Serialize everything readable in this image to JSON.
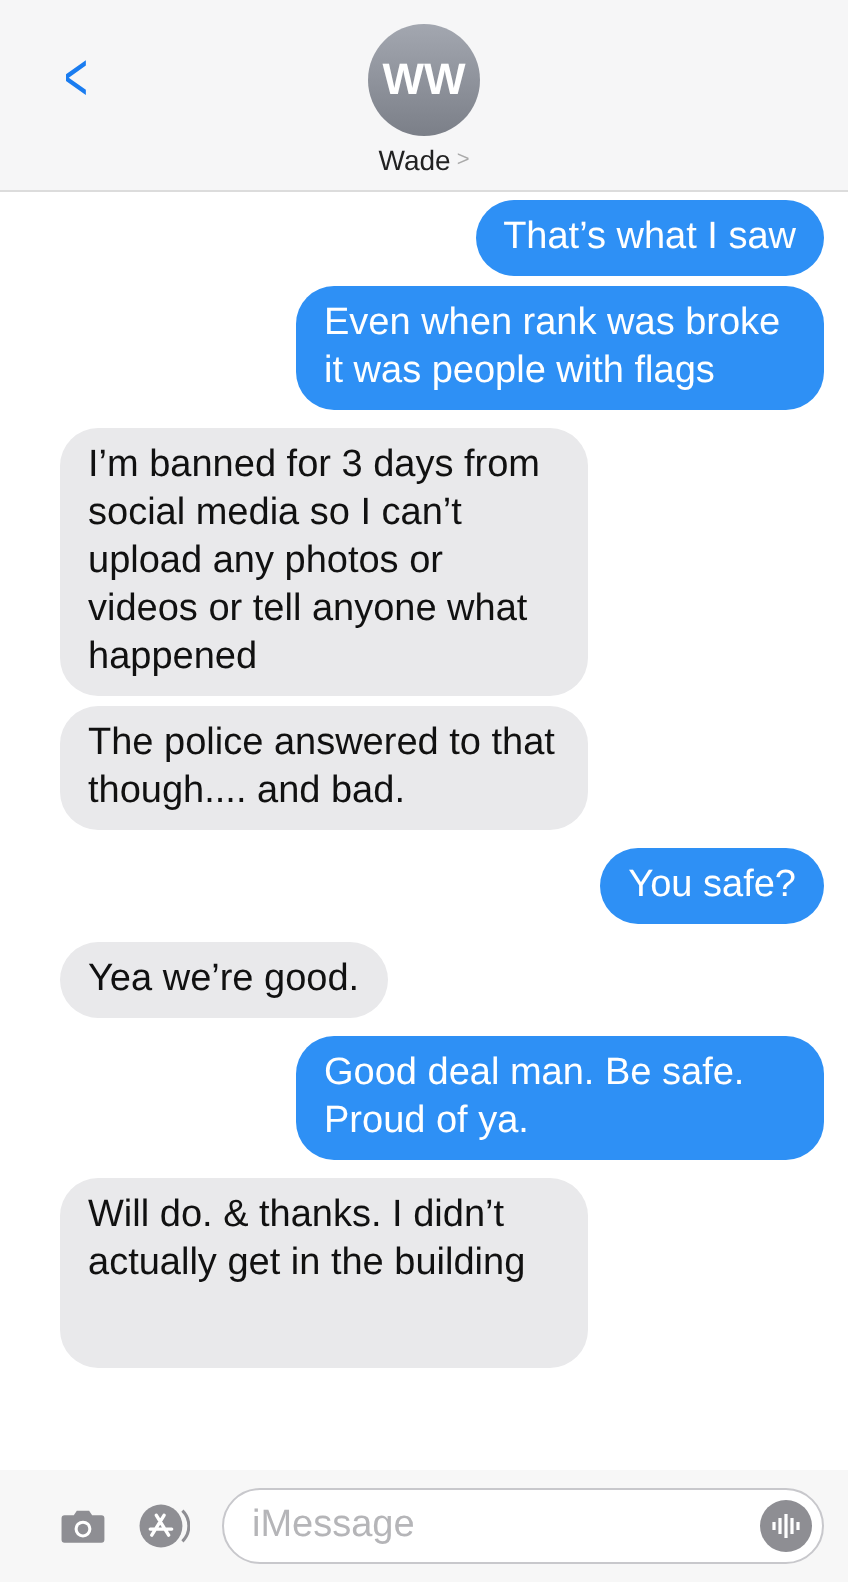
{
  "header": {
    "back": "<",
    "avatar_initials": "WW",
    "contact_name": "Wade",
    "contact_chevron": ">"
  },
  "messages": [
    {
      "kind": "sent",
      "text": "That’s what I saw"
    },
    {
      "kind": "sent",
      "text": "Even when rank was broke it was people with flags"
    },
    {
      "kind": "received",
      "text": "I’m banned for 3 days from social media so I can’t upload any photos or videos or tell anyone what happened"
    },
    {
      "kind": "received",
      "text": "The police answered to that though.... and bad."
    },
    {
      "kind": "sent",
      "text": "You safe?"
    },
    {
      "kind": "received",
      "text": "Yea we’re good."
    },
    {
      "kind": "sent",
      "text": "Good deal man. Be safe. Proud of ya."
    },
    {
      "kind": "received",
      "text": "Will do. & thanks. I didn’t actually get in the building"
    }
  ],
  "composer": {
    "placeholder": "iMessage"
  }
}
